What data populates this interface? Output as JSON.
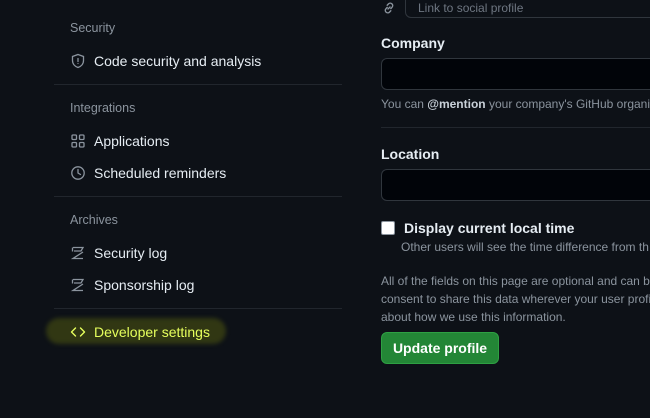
{
  "sidebar": {
    "sections": {
      "security": {
        "title": "Security",
        "items": [
          {
            "label": "Code security and analysis",
            "icon": "shield-icon"
          }
        ]
      },
      "integrations": {
        "title": "Integrations",
        "items": [
          {
            "label": "Applications",
            "icon": "apps-grid-icon"
          },
          {
            "label": "Scheduled reminders",
            "icon": "clock-icon"
          }
        ]
      },
      "archives": {
        "title": "Archives",
        "items": [
          {
            "label": "Security log",
            "icon": "log-icon"
          },
          {
            "label": "Sponsorship log",
            "icon": "log-icon"
          }
        ]
      }
    },
    "developer_settings": {
      "label": "Developer settings",
      "icon": "code-icon",
      "highlight_color": "#e6ff5c"
    }
  },
  "profile_form": {
    "social": {
      "placeholder": "Link to social profile",
      "icon": "link-icon"
    },
    "company": {
      "label": "Company",
      "value": "",
      "note_pre": "You can ",
      "note_mention": "@mention",
      "note_post": " your company's GitHub organi"
    },
    "location": {
      "label": "Location",
      "value": ""
    },
    "local_time": {
      "label": "Display current local time",
      "checked": false,
      "note": "Other users will see the time difference from th"
    },
    "footer": {
      "line1": "All of the fields on this page are optional and can b",
      "line2": "consent to share this data wherever your user profi",
      "line3": "about how we use this information."
    },
    "update_button": {
      "label": "Update profile",
      "color": "#238636"
    }
  }
}
